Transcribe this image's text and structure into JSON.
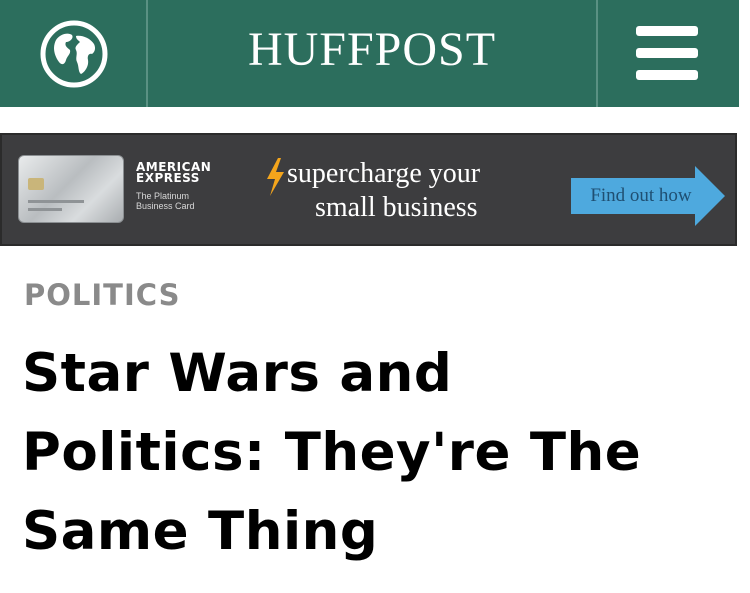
{
  "header": {
    "logo_text": "HUFFPOST",
    "background_color": "#2c6e5d",
    "globe_icon": "globe-icon",
    "menu_icon": "hamburger-menu-icon"
  },
  "ad": {
    "brand_line1": "AMERICAN",
    "brand_line2": "EXPRESS",
    "card_name_line1": "The Platinum",
    "card_name_line2": "Business Card",
    "headline_line1": "supercharge your",
    "headline_line2": "small business",
    "cta_label": "Find out how",
    "accent_color": "#f4a51c",
    "cta_color": "#4ea9de"
  },
  "article": {
    "section": "POLITICS",
    "headline_line1": "Star Wars and",
    "headline_line2": "Politics: They're The",
    "headline_line3": "Same Thing"
  }
}
